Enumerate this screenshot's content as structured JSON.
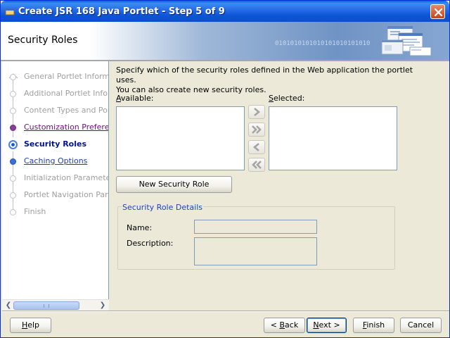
{
  "window": {
    "title": "Create JSR 168 Java Portlet - Step 5 of 9"
  },
  "header": {
    "title": "Security Roles",
    "binary_text": "0101010101010101010101010"
  },
  "nav": {
    "items": [
      {
        "label": "General Portlet Information",
        "state": "disabled"
      },
      {
        "label": "Additional Portlet Information",
        "state": "disabled"
      },
      {
        "label": "Content Types and Portlet Modes",
        "state": "disabled"
      },
      {
        "label": "Customization Preferences",
        "state": "visited"
      },
      {
        "label": "Security Roles",
        "state": "active"
      },
      {
        "label": "Caching Options",
        "state": "link"
      },
      {
        "label": "Initialization Parameters",
        "state": "disabled"
      },
      {
        "label": "Portlet Navigation Parameters",
        "state": "disabled"
      },
      {
        "label": "Finish",
        "state": "disabled"
      }
    ]
  },
  "main": {
    "description_line1": "Specify which of the security roles defined in the Web application the portlet uses.",
    "description_line2": "You can also create new security roles.",
    "available_label_mnemonic": "A",
    "available_label_rest": "vailable:",
    "selected_label_mnemonic": "S",
    "selected_label_rest": "elected:",
    "new_role_button": "New Security Role",
    "details_title": "Security Role Details",
    "name_label": "Name:",
    "description_label": "Description:"
  },
  "footer": {
    "help_mnemonic": "H",
    "help_rest": "elp",
    "back_prefix": "< ",
    "back_mnemonic": "B",
    "back_rest": "ack",
    "next_mnemonic": "N",
    "next_rest": "ext >",
    "finish_mnemonic": "F",
    "finish_rest": "inish",
    "cancel": "Cancel"
  },
  "colors": {
    "titlebar": "#0b4fd0",
    "link": "#1c3fa8",
    "visited": "#6a0f7a",
    "active": "#00158a",
    "group_title": "#1c46b8"
  }
}
